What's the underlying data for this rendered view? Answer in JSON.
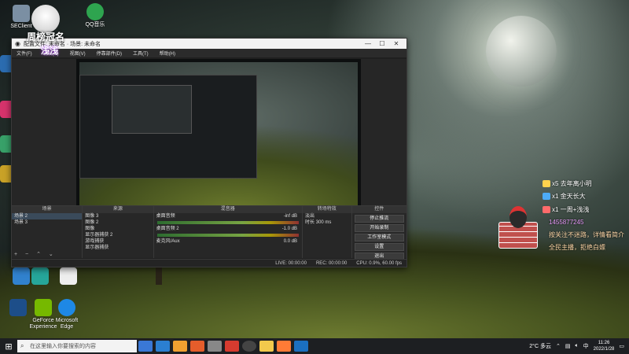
{
  "desktop": {
    "icons": [
      {
        "label": "SEClient",
        "color": "#7b8fa3"
      },
      {
        "label": "QQ音乐",
        "color": "#2ea44f"
      },
      {
        "label": "",
        "color": "#2b6cb0"
      },
      {
        "label": "",
        "color": "#c9a227"
      },
      {
        "label": "",
        "color": "#d6336c"
      },
      {
        "label": "",
        "color": "#38a169"
      },
      {
        "label": "",
        "color": "#3182ce"
      },
      {
        "label": "GeForce Experience",
        "color": "#76b900"
      },
      {
        "label": "Microsoft Edge",
        "color": "#1e88e5"
      },
      {
        "label": "",
        "color": "#26a69a"
      }
    ]
  },
  "overlay": {
    "streamer_name": "周榜冠名",
    "streamer_sub": "浅浅"
  },
  "obs": {
    "title": "配置文件: 未命名 · 场景: 未命名",
    "menu": [
      "文件(F)",
      "编辑(E)",
      "视图(V)",
      "停靠部件(D)",
      "工具(T)",
      "帮助(H)"
    ],
    "docks": {
      "scenes_header": "场景",
      "scenes": [
        "场景 2",
        "场景 3"
      ],
      "sources_header": "来源",
      "sources": [
        "图像 3",
        "图像 2",
        "图像",
        "显示器捕获 2",
        "游戏捕获",
        "显示器捕获"
      ],
      "mixer_header": "混音器",
      "mixer": [
        {
          "name": "桌面音频",
          "level": "-inf dB"
        },
        {
          "name": "麦克风/Aux",
          "level": "0.0 dB"
        },
        {
          "name": "桌面音频 2",
          "level": "-1.0 dB"
        }
      ],
      "transitions_header": "转场特效",
      "transition_type": "淡出",
      "duration_label": "时长",
      "duration_value": "300 ms",
      "controls_header": "控件",
      "controls": [
        "停止推流",
        "开始录制",
        "工作室模式",
        "设置",
        "退出"
      ]
    },
    "status": {
      "live": "LIVE: 00:00:00",
      "rec": "REC: 00:00:00",
      "cpu": "CPU: 0.9%, 60.00 fps"
    }
  },
  "chat": [
    {
      "text": "x5 去年离小明",
      "color": "#ffd24d"
    },
    {
      "text": "x1 金天长大",
      "color": "#4dabf7"
    },
    {
      "text": "x1 一周+浅浅",
      "color": "#ff6b6b"
    },
    {
      "text": "1455877245",
      "color": "#e599f7"
    },
    {
      "text": "按关注不迷路，详情看简介",
      "color": "#ffd8a8"
    },
    {
      "text": "全民主播，拒绝白嫖",
      "color": "#ffd8a8"
    }
  ],
  "taskbar": {
    "search_placeholder": "在这里输入你要搜索的内容",
    "weather": "2°C 多云",
    "time": "11:26",
    "date": "2022/1/28",
    "ime": "中",
    "apps": [
      "#3a78d6",
      "#2b7fd1",
      "#f0a030",
      "#e55d2b",
      "#888888",
      "#d63b2f",
      "#2f9bd6",
      "#47a0e8",
      "#f2c94c",
      "#ff7b36",
      "#1b6fbf"
    ]
  }
}
